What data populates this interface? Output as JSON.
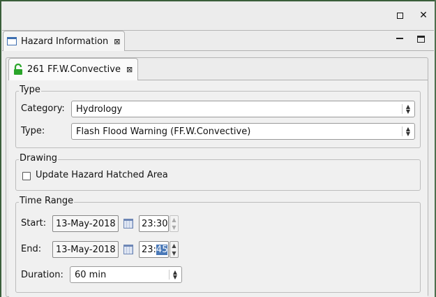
{
  "window": {
    "controls": {
      "maximize_icon": "maximize-icon",
      "close_glyph": "✕"
    }
  },
  "view": {
    "tab_label": "Hazard Information",
    "tab_close": "⊠"
  },
  "hazard_tab": {
    "label": "261 FF.W.Convective",
    "close": "⊠",
    "lock_color": "#2aa52a"
  },
  "type_group": {
    "title": "Type",
    "category_label": "Category:",
    "category_value": "Hydrology",
    "type_label": "Type:",
    "type_value": "Flash Flood Warning (FF.W.Convective)"
  },
  "drawing_group": {
    "title": "Drawing",
    "checkbox_label": "Update Hazard Hatched Area",
    "checked": false
  },
  "time_group": {
    "title": "Time Range",
    "start_label": "Start:",
    "start_date": "13-May-2018",
    "start_time": "23:30",
    "end_label": "End:",
    "end_date": "13-May-2018",
    "end_time_hours": "23:",
    "end_time_minutes": "45",
    "duration_label": "Duration:",
    "duration_value": "60 min"
  },
  "colors": {
    "selection": "#4a79b8",
    "icon_blue": "#3e6fb0"
  }
}
